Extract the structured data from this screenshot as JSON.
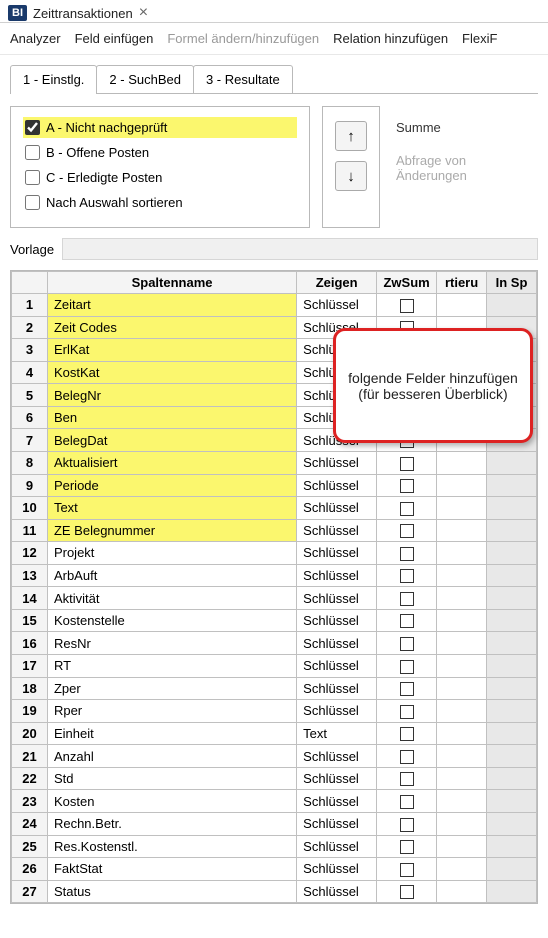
{
  "header": {
    "badge": "BI",
    "title": "Zeittransaktionen",
    "close": "×"
  },
  "menubar": {
    "analyzer": "Analyzer",
    "feld": "Feld einfügen",
    "formel": "Formel ändern/hinzufügen",
    "relation": "Relation hinzufügen",
    "flexi": "FlexiF"
  },
  "subtabs": {
    "t1": "1 - Einstlg.",
    "t2": "2 - SuchBed",
    "t3": "3 - Resultate"
  },
  "checks": {
    "a": "A - Nicht nachgeprüft",
    "b": "B - Offene Posten",
    "c": "C - Erledigte Posten",
    "sort": "Nach Auswahl sortieren"
  },
  "arrows": {
    "up": "↑",
    "down": "↓"
  },
  "right": {
    "summe": "Summe",
    "abfrage": "Abfrage von Änderungen"
  },
  "vorlage": {
    "label": "Vorlage"
  },
  "gridHeaders": {
    "spalte": "Spaltenname",
    "zeigen": "Zeigen",
    "zwsum": "ZwSum",
    "sort": "rtieru",
    "insp": "In Sp"
  },
  "rows": [
    {
      "n": "1",
      "name": "Zeitart",
      "zeigen": "Schlüssel",
      "hl": true
    },
    {
      "n": "2",
      "name": "Zeit Codes",
      "zeigen": "Schlüssel",
      "hl": true
    },
    {
      "n": "3",
      "name": "ErlKat",
      "zeigen": "Schlüssel",
      "hl": true
    },
    {
      "n": "4",
      "name": "KostKat",
      "zeigen": "Schlüssel",
      "hl": true
    },
    {
      "n": "5",
      "name": "BelegNr",
      "zeigen": "Schlüssel",
      "hl": true
    },
    {
      "n": "6",
      "name": "Ben",
      "zeigen": "Schlüssel",
      "hl": true
    },
    {
      "n": "7",
      "name": "BelegDat",
      "zeigen": "Schlüssel",
      "hl": true
    },
    {
      "n": "8",
      "name": "Aktualisiert",
      "zeigen": "Schlüssel",
      "hl": true
    },
    {
      "n": "9",
      "name": "Periode",
      "zeigen": "Schlüssel",
      "hl": true
    },
    {
      "n": "10",
      "name": "Text",
      "zeigen": "Schlüssel",
      "hl": true
    },
    {
      "n": "11",
      "name": "ZE Belegnummer",
      "zeigen": "Schlüssel",
      "hl": true
    },
    {
      "n": "12",
      "name": "Projekt",
      "zeigen": "Schlüssel",
      "hl": false
    },
    {
      "n": "13",
      "name": "ArbAuft",
      "zeigen": "Schlüssel",
      "hl": false
    },
    {
      "n": "14",
      "name": "Aktivität",
      "zeigen": "Schlüssel",
      "hl": false
    },
    {
      "n": "15",
      "name": "Kostenstelle",
      "zeigen": "Schlüssel",
      "hl": false
    },
    {
      "n": "16",
      "name": "ResNr",
      "zeigen": "Schlüssel",
      "hl": false
    },
    {
      "n": "17",
      "name": "RT",
      "zeigen": "Schlüssel",
      "hl": false
    },
    {
      "n": "18",
      "name": "Zper",
      "zeigen": "Schlüssel",
      "hl": false
    },
    {
      "n": "19",
      "name": "Rper",
      "zeigen": "Schlüssel",
      "hl": false
    },
    {
      "n": "20",
      "name": "Einheit",
      "zeigen": "Text",
      "hl": false
    },
    {
      "n": "21",
      "name": "Anzahl",
      "zeigen": "Schlüssel",
      "hl": false
    },
    {
      "n": "22",
      "name": "Std",
      "zeigen": "Schlüssel",
      "hl": false
    },
    {
      "n": "23",
      "name": "Kosten",
      "zeigen": "Schlüssel",
      "hl": false
    },
    {
      "n": "24",
      "name": "Rechn.Betr.",
      "zeigen": "Schlüssel",
      "hl": false
    },
    {
      "n": "25",
      "name": "Res.Kostenstl.",
      "zeigen": "Schlüssel",
      "hl": false
    },
    {
      "n": "26",
      "name": "FaktStat",
      "zeigen": "Schlüssel",
      "hl": false
    },
    {
      "n": "27",
      "name": "Status",
      "zeigen": "Schlüssel",
      "hl": false
    }
  ],
  "callout": "folgende Felder hinzufügen (für besseren Überblick)"
}
